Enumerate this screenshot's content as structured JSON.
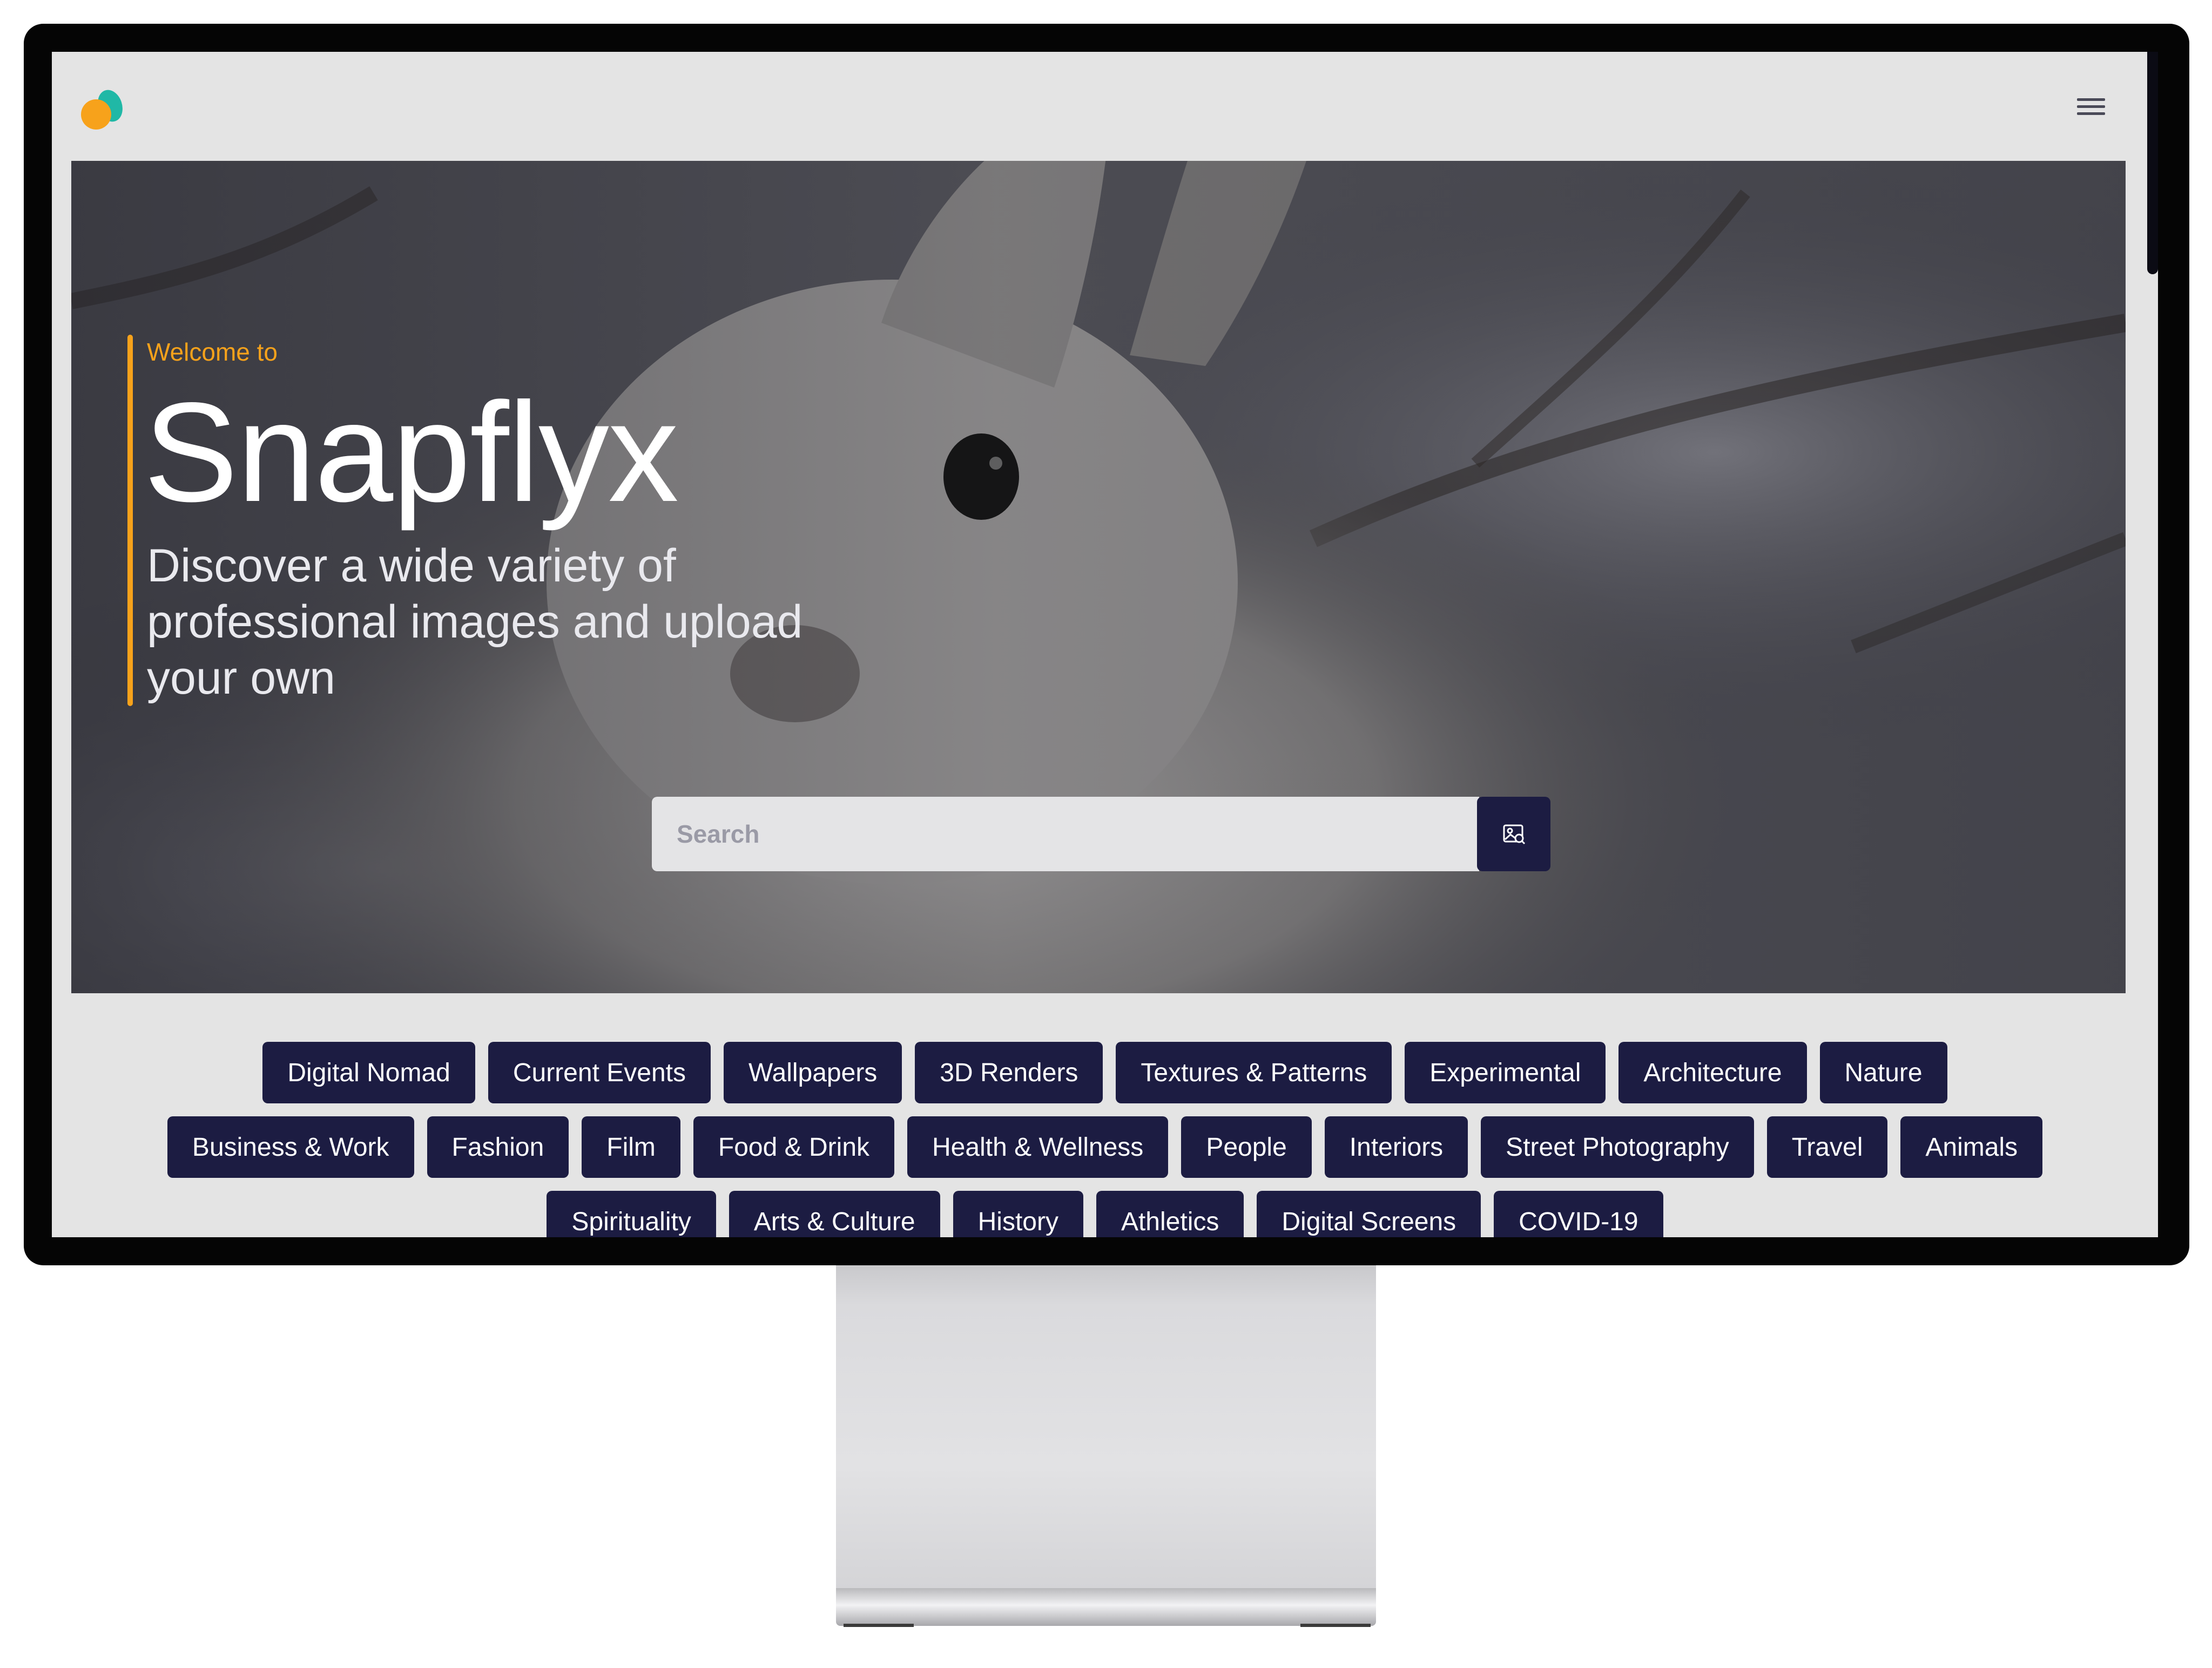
{
  "brand": {
    "accent_color": "#f7a21b",
    "secondary_color": "#20b8a6",
    "chip_color": "#1c1c42"
  },
  "hero": {
    "welcome": "Welcome to",
    "title": "Snapflyx",
    "subtitle": "Discover a wide variety of professional images and upload your own"
  },
  "search": {
    "placeholder": "Search",
    "button_icon": "image-search-icon"
  },
  "nav": {
    "menu_icon": "hamburger-menu-icon"
  },
  "categories": {
    "rows": [
      [
        "Digital Nomad",
        "Current Events",
        "Wallpapers",
        "3D Renders",
        "Textures & Patterns",
        "Experimental",
        "Architecture",
        "Nature"
      ],
      [
        "Business & Work",
        "Fashion",
        "Film",
        "Food & Drink",
        "Health & Wellness",
        "People",
        "Interiors",
        "Street Photography",
        "Travel",
        "Animals"
      ],
      [
        "Spirituality",
        "Arts & Culture",
        "History",
        "Athletics",
        "Digital Screens",
        "COVID-19"
      ]
    ]
  }
}
